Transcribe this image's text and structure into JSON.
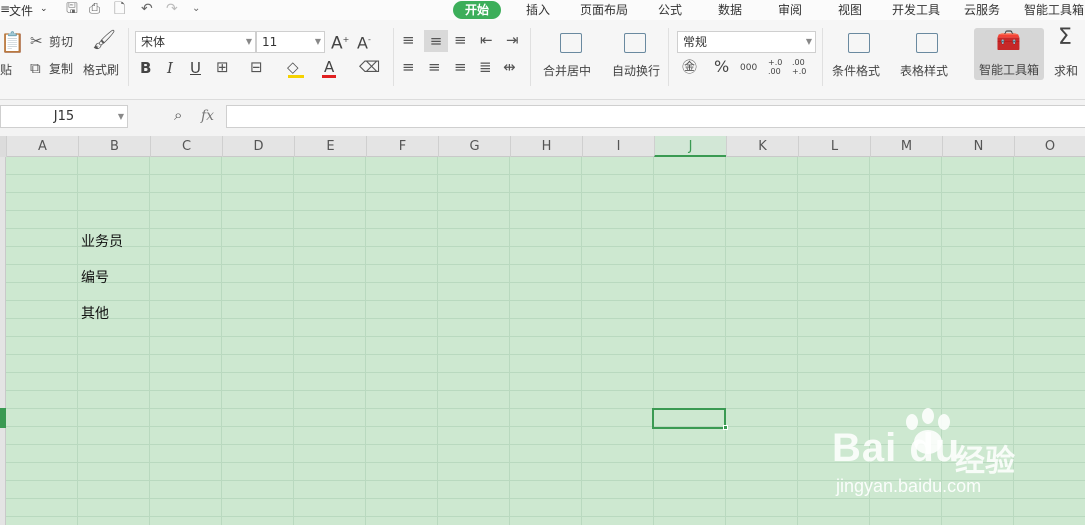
{
  "menubar": {
    "file_label": "文件",
    "tabs": [
      "开始",
      "插入",
      "页面布局",
      "公式",
      "数据",
      "审阅",
      "视图",
      "开发工具",
      "云服务",
      "智能工具箱"
    ],
    "active_tab": "开始"
  },
  "ribbon": {
    "paste_label": "贴",
    "cut_label": "剪切",
    "copy_label": "复制",
    "format_painter_label": "格式刷",
    "font_name": "宋体",
    "font_size": "11",
    "merge_center_label": "合并居中",
    "wrap_text_label": "自动换行",
    "number_format": "常规",
    "conditional_format_label": "条件格式",
    "table_style_label": "表格样式",
    "smart_toolbox_label": "智能工具箱",
    "sum_label": "求和",
    "percent_label": "%",
    "thousands_label": "000",
    "inc_decimal_label": "+.0 .00",
    "dec_decimal_label": ".00 +.0"
  },
  "formula_bar": {
    "name_box": "J15",
    "fx_label": "fx",
    "formula_value": ""
  },
  "sheet": {
    "columns": [
      "A",
      "B",
      "C",
      "D",
      "E",
      "F",
      "G",
      "H",
      "I",
      "J",
      "K",
      "L",
      "M",
      "N",
      "O"
    ],
    "selected_column": "J",
    "cells": [
      {
        "ref": "B4",
        "value": "业务员"
      },
      {
        "ref": "B6",
        "value": "编号"
      },
      {
        "ref": "B8",
        "value": "其他"
      }
    ]
  },
  "watermark": {
    "brand": "Bai du",
    "chinese": "经验",
    "url": "jingyan.baidu.com"
  },
  "colors": {
    "accent_green": "#3cae5a",
    "grid_background": "#cde8d0",
    "selection_border": "#3a9a52"
  }
}
